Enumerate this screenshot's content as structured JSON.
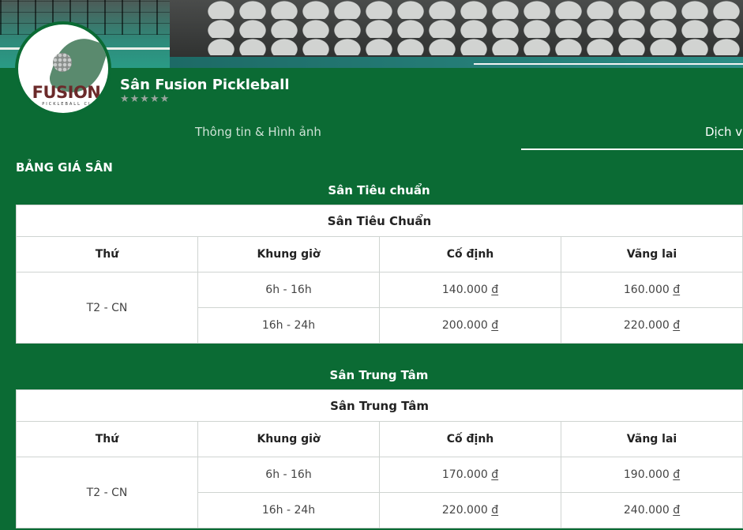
{
  "venue": {
    "name": "Sân Fusion Pickleball",
    "stars": "★★★★★",
    "logo_text": "FUSION",
    "logo_subtext": "PICKLEBALL CL"
  },
  "tabs": [
    {
      "label": "Thông tin & Hình ảnh"
    },
    {
      "label": "Dịch vụ"
    }
  ],
  "pricing": {
    "section_title": "BẢNG GIÁ SÂN",
    "courts": [
      {
        "heading": "Sân Tiêu chuẩn",
        "table_caption": "Sân Tiêu Chuẩn",
        "columns": [
          "Thứ",
          "Khung giờ",
          "Cố định",
          "Vãng lai"
        ],
        "day": "T2 - CN",
        "rows": [
          {
            "slot": "6h - 16h",
            "fixed": "140.000",
            "walkin": "160.000"
          },
          {
            "slot": "16h - 24h",
            "fixed": "200.000",
            "walkin": "220.000"
          }
        ]
      },
      {
        "heading": "Sân Trung Tâm",
        "table_caption": "Sân Trung Tâm",
        "columns": [
          "Thứ",
          "Khung giờ",
          "Cố định",
          "Vãng lai"
        ],
        "day": "T2 - CN",
        "rows": [
          {
            "slot": "6h - 16h",
            "fixed": "170.000",
            "walkin": "190.000"
          },
          {
            "slot": "16h - 24h",
            "fixed": "220.000",
            "walkin": "240.000"
          }
        ]
      }
    ],
    "currency_symbol": "đ"
  },
  "colors": {
    "brand_green": "#0b6b34",
    "table_bg": "#ffffff"
  }
}
